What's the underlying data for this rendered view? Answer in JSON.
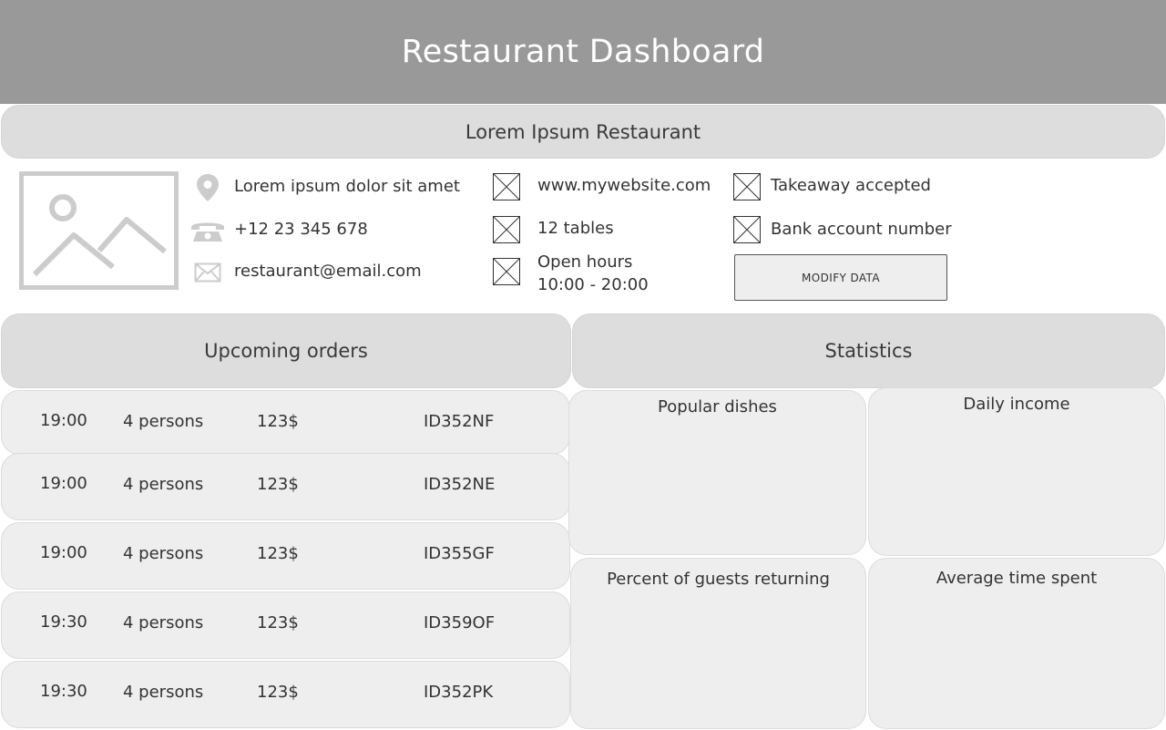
{
  "header": {
    "title": "Restaurant Dashboard"
  },
  "restaurant": {
    "name": "Lorem Ipsum Restaurant",
    "address": "Lorem ipsum dolor sit amet",
    "phone": "+12 23 345 678",
    "email": "restaurant@email.com",
    "website": "www.mywebsite.com",
    "tables": "12 tables",
    "hours_label": "Open hours",
    "hours_value": "10:00 - 20:00",
    "takeaway": "Takeaway accepted",
    "bank": "Bank account number",
    "modify_label": "MODIFY DATA"
  },
  "orders": {
    "title": "Upcoming orders",
    "rows": [
      {
        "time": "19:00",
        "persons": "4 persons",
        "price": "123$",
        "id": "ID352NF"
      },
      {
        "time": "19:00",
        "persons": "4 persons",
        "price": "123$",
        "id": "ID352NE"
      },
      {
        "time": "19:00",
        "persons": "4 persons",
        "price": "123$",
        "id": "ID355GF"
      },
      {
        "time": "19:30",
        "persons": "4 persons",
        "price": "123$",
        "id": "ID359OF"
      },
      {
        "time": "19:30",
        "persons": "4 persons",
        "price": "123$",
        "id": "ID352PK"
      }
    ]
  },
  "statistics": {
    "title": "Statistics",
    "cards": [
      {
        "title": "Popular dishes"
      },
      {
        "title": "Daily income"
      },
      {
        "title": "Percent of guests returning"
      },
      {
        "title": "Average time spent"
      }
    ]
  },
  "icons": {
    "location": "map-pin-icon",
    "phone": "phone-icon",
    "email": "envelope-icon",
    "placeholder": "image-placeholder-icon"
  },
  "colors": {
    "header_bg": "#999999",
    "panel_bg": "#dddddd",
    "card_bg": "#eeeeee",
    "icon_gray": "#cccccc"
  }
}
